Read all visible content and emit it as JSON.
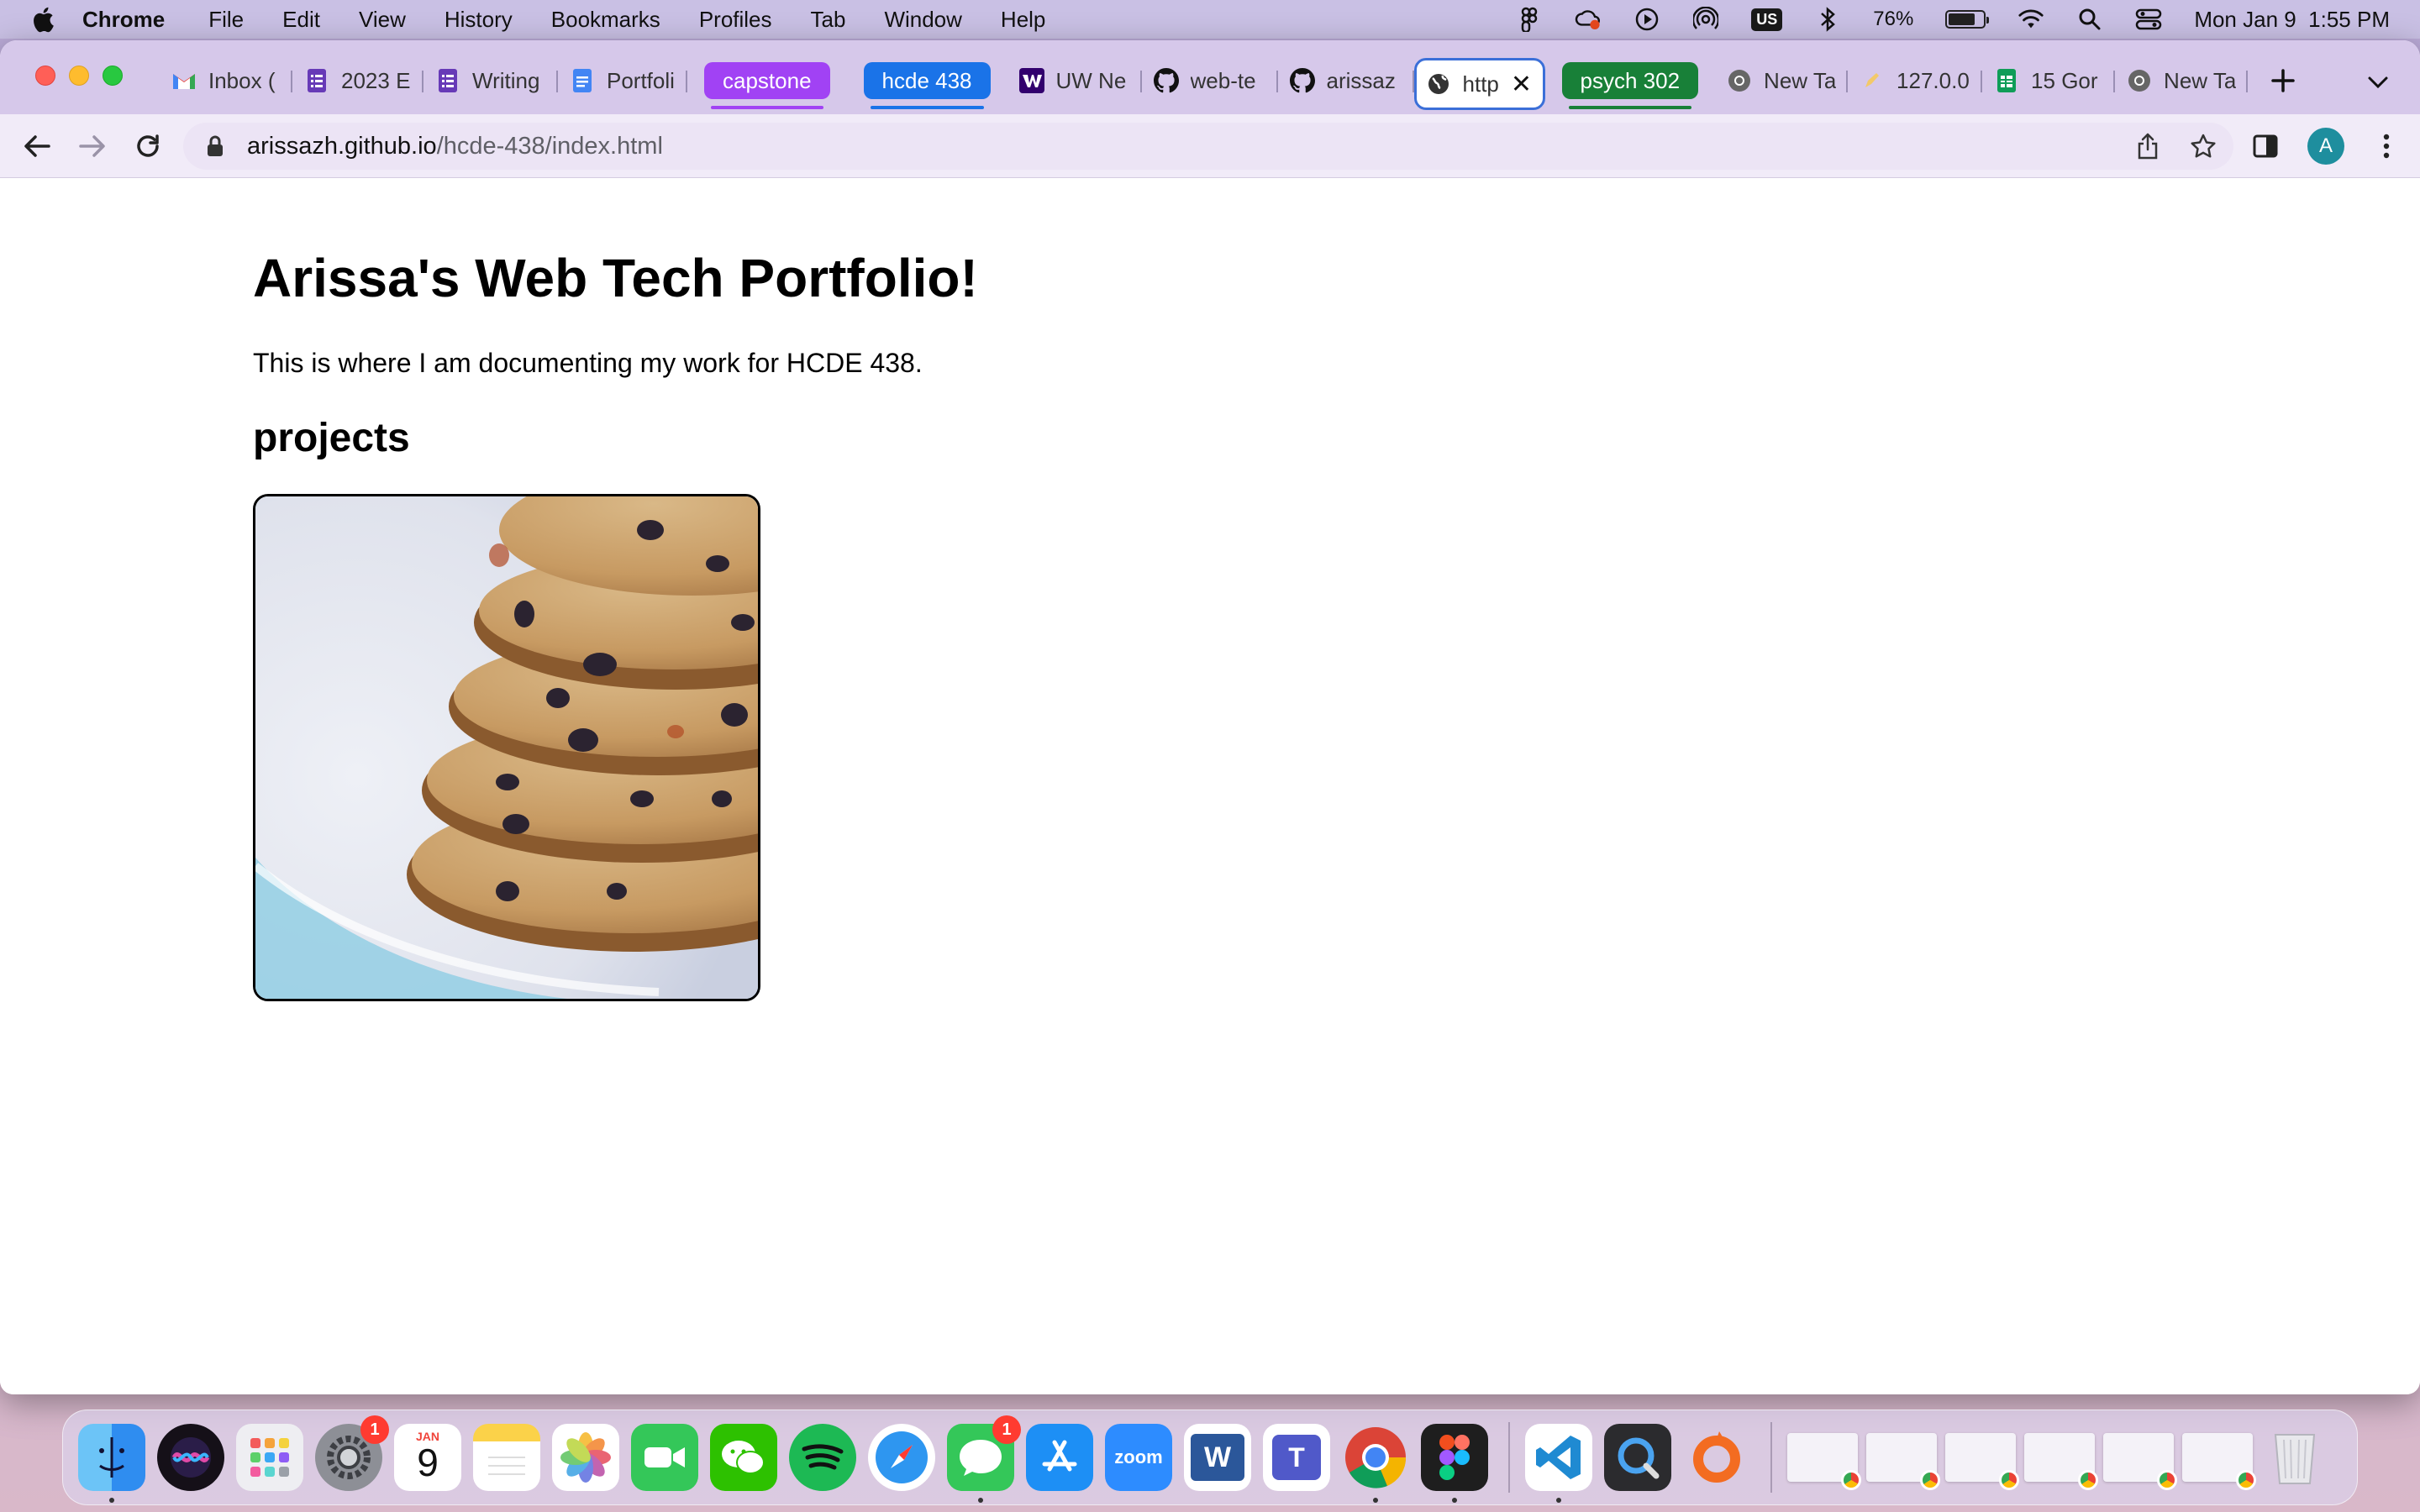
{
  "menubar": {
    "app_name": "Chrome",
    "items": [
      "File",
      "Edit",
      "View",
      "History",
      "Bookmarks",
      "Profiles",
      "Tab",
      "Window",
      "Help"
    ],
    "keyboard_layout": "US",
    "battery_percent": "76%",
    "battery_level": 0.76,
    "datetime": "Mon Jan 9  1:55 PM"
  },
  "tabs": {
    "items": [
      {
        "title": "Inbox (",
        "icon": "gmail-icon"
      },
      {
        "title": "2023 E",
        "icon": "forms-icon"
      },
      {
        "title": "Writing",
        "icon": "forms-icon"
      }
    ],
    "group_capstone": "capstone",
    "items2": [
      {
        "title": "Portfoli",
        "icon": "docs-icon"
      }
    ],
    "group_hcde": "hcde 438",
    "items3": [
      {
        "title": "UW Ne",
        "icon": "uw-icon"
      },
      {
        "title": "web-te",
        "icon": "github-icon"
      },
      {
        "title": "arissaz",
        "icon": "github-icon"
      }
    ],
    "active_title": "http",
    "group_psych": "psych 302",
    "items4": [
      {
        "title": "New Ta",
        "icon": "chrome-icon"
      },
      {
        "title": "127.0.0",
        "icon": "pencil-icon"
      },
      {
        "title": "15 Gor",
        "icon": "sheets-icon"
      },
      {
        "title": "New Ta",
        "icon": "chrome-icon"
      }
    ]
  },
  "address_bar": {
    "host": "arissazh.github.io",
    "path": "/hcde-438/index.html"
  },
  "profile_initial": "A",
  "page": {
    "heading": "Arissa's Web Tech Portfolio!",
    "intro": "This is where I am documenting my work for HCDE 438.",
    "section_heading": "projects"
  },
  "dock": {
    "calendar_month": "JAN",
    "calendar_day": "9",
    "settings_badge": "1",
    "messages_badge": "1",
    "zoom_label": "zoom",
    "word_label": "W",
    "teams_label": "T"
  }
}
